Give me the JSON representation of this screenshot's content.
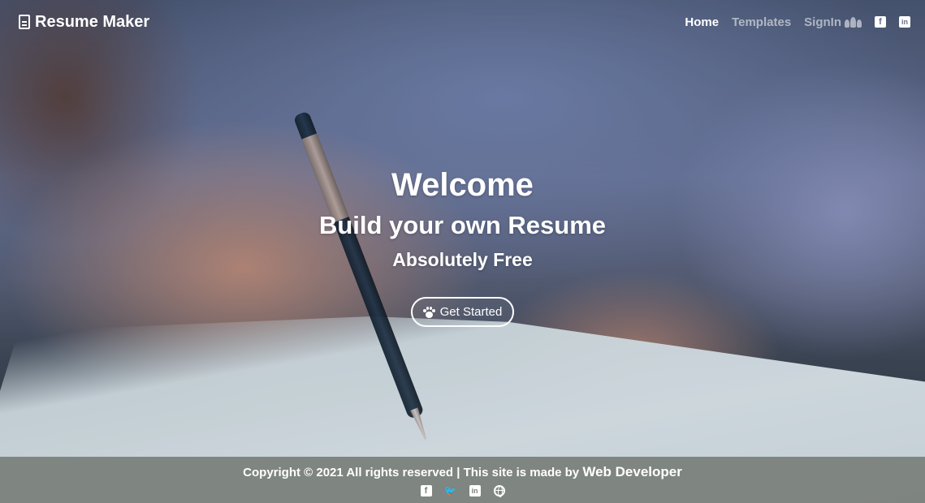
{
  "brand": {
    "icon": "file-text-icon",
    "title": "Resume Maker"
  },
  "nav": {
    "home": "Home",
    "templates": "Templates",
    "signin": "SignIn",
    "signin_icon": "users-icon",
    "social": [
      {
        "icon": "facebook-icon",
        "glyph": "f"
      },
      {
        "icon": "linkedin-icon",
        "glyph": "in"
      }
    ]
  },
  "hero": {
    "title": "Welcome",
    "subtitle": "Build your own Resume",
    "tagline": "Absolutely Free",
    "cta_label": "Get Started",
    "cta_icon": "paw-icon"
  },
  "footer": {
    "copyright": "Copyright © 2021 All rights reserved | This site is made by ",
    "author": "Web Developer",
    "icons": [
      "facebook-icon",
      "twitter-icon",
      "linkedin-icon",
      "globe-icon"
    ],
    "facebook_glyph": "f",
    "twitter_glyph": "🐦",
    "linkedin_glyph": "in"
  },
  "colors": {
    "text": "#ffffff",
    "muted_nav": "#b9bdd0",
    "footer_bg": "#787e78"
  }
}
